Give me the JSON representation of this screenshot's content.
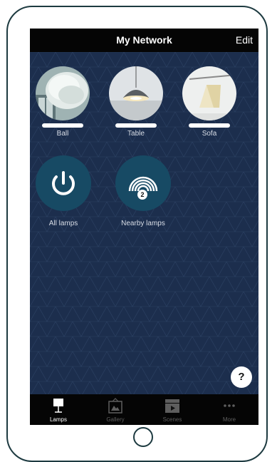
{
  "header": {
    "title": "My Network",
    "edit_label": "Edit"
  },
  "lamps": [
    {
      "label": "Ball"
    },
    {
      "label": "Table"
    },
    {
      "label": "Sofa"
    }
  ],
  "actions": {
    "all_lamps": {
      "label": "All lamps",
      "icon": "power-icon"
    },
    "nearby_lamps": {
      "label": "Nearby lamps",
      "icon": "signal-icon",
      "badge": "2"
    }
  },
  "help_label": "?",
  "tabs": [
    {
      "label": "Lamps",
      "icon": "lamp-icon",
      "active": true
    },
    {
      "label": "Gallery",
      "icon": "gallery-icon",
      "active": false
    },
    {
      "label": "Scenes",
      "icon": "scenes-icon",
      "active": false
    },
    {
      "label": "More",
      "icon": "more-icon",
      "active": false
    }
  ],
  "colors": {
    "background": "#1c2e4d",
    "bars": "#050505",
    "action_circle": "#174a64"
  }
}
